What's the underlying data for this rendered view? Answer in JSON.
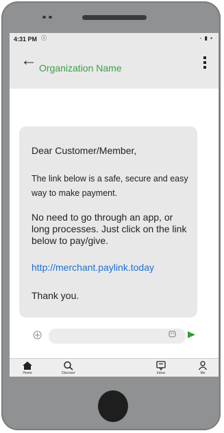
{
  "status": {
    "time": "4:31 PM",
    "signal_glyph": "ⓘ",
    "right_icons": "- ▮ ▪"
  },
  "appbar": {
    "title": "Organization Name",
    "back_icon": "arrow-left",
    "menu_icon": "vertical-dots"
  },
  "message": {
    "greeting": "Dear Customer/Member,",
    "paragraph1": "The link below is a safe, secure and easy way to make payment.",
    "paragraph2": "No need to go through an app, or long processes. Just click on the link below to pay/give.",
    "link": "http://merchant.paylink.today",
    "closing": "Thank you."
  },
  "compose": {
    "value": "",
    "attach_icon": "attach",
    "emoji_icon": "emoji",
    "send_icon": "send"
  },
  "tabs": [
    {
      "label": "Home",
      "icon": "home"
    },
    {
      "label": "Discover",
      "icon": "search"
    },
    {
      "label": "Inbox",
      "icon": "inbox"
    },
    {
      "label": "Me",
      "icon": "person"
    }
  ],
  "colors": {
    "accent": "#3aa046",
    "link": "#1f6fd1",
    "phone_body": "#8f9193",
    "bubble": "#e8e8e8"
  }
}
